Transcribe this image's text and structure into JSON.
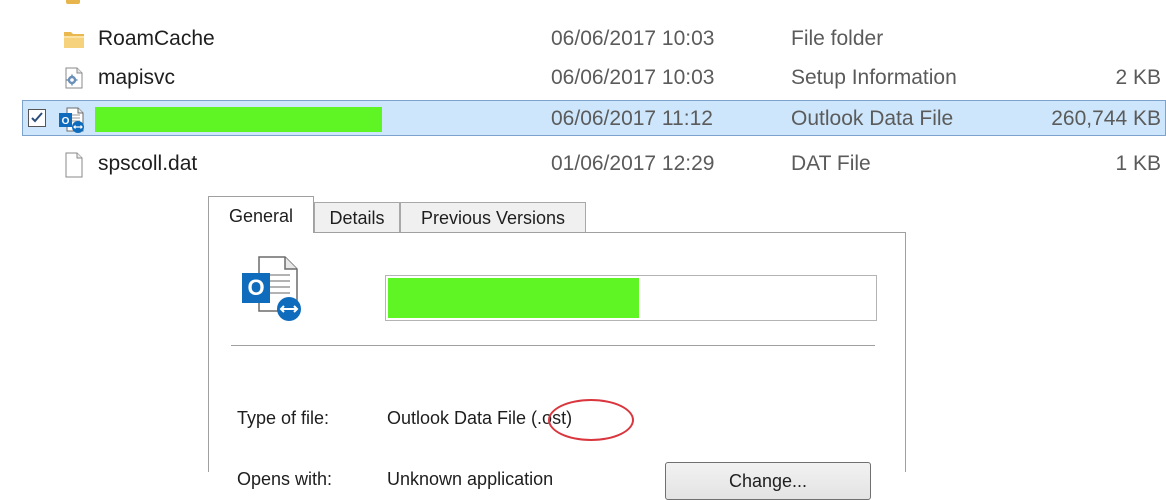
{
  "files": [
    {
      "name": "RoamCache",
      "date": "06/06/2017 10:03",
      "type": "File folder",
      "size": "",
      "icon": "folder-icon"
    },
    {
      "name": "mapisvc",
      "date": "06/06/2017 10:03",
      "type": "Setup Information",
      "size": "2 KB",
      "icon": "setup-info-icon"
    },
    {
      "name": "",
      "date": "06/06/2017 11:12",
      "type": "Outlook Data File",
      "size": "260,744 KB",
      "icon": "outlook-data-file-icon",
      "selected": true,
      "checked": true,
      "redaction_color": "#5ff423"
    },
    {
      "name": "spscoll.dat",
      "date": "01/06/2017 12:29",
      "type": "DAT File",
      "size": "1 KB",
      "icon": "document-icon"
    }
  ],
  "dialog": {
    "tabs": [
      {
        "label": "General",
        "active": true
      },
      {
        "label": "Details",
        "active": false
      },
      {
        "label": "Previous Versions",
        "active": false
      }
    ],
    "file_icon": "outlook-data-file-icon",
    "redaction_color": "#5ff423",
    "type_label": "Type of file:",
    "type_value": "Outlook Data File (.ost)",
    "opens_label": "Opens with:",
    "opens_value": "Unknown application",
    "change_label": "Change...",
    "highlight_color": "#d9363e"
  },
  "colors": {
    "selection_bg": "#cde6fb",
    "selection_border": "#7da2ce",
    "outlook_blue": "#0f6cbd"
  }
}
